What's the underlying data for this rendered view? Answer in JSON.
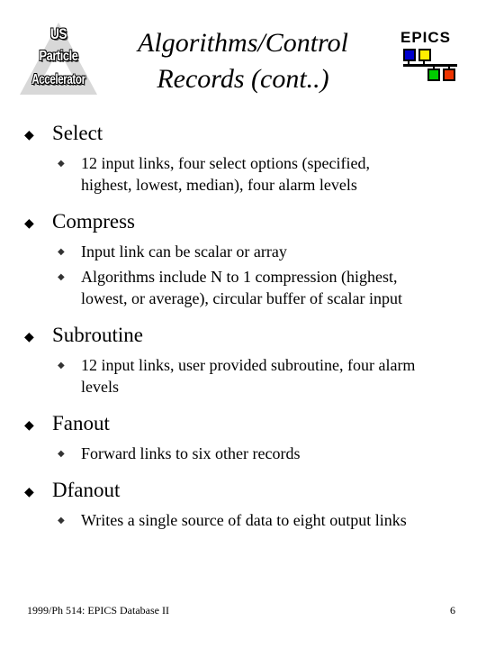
{
  "header": {
    "logo": {
      "line1": "US",
      "line2": "Particle",
      "line3": "Accelerator"
    },
    "title_line1": "Algorithms/Control",
    "title_line2": "Records (cont..)",
    "epics_label": "EPICS",
    "epics_colors": [
      "#0000cc",
      "#ffee00",
      "#00cc00",
      "#ee3300"
    ]
  },
  "bullets": [
    {
      "label": "Select",
      "subs": [
        [
          "12 input links, four select options (specified,",
          "highest, lowest, median), four alarm levels"
        ]
      ]
    },
    {
      "label": "Compress",
      "subs": [
        [
          "Input link can be scalar or array"
        ],
        [
          "Algorithms include N to 1 compression (highest,",
          "lowest, or average), circular buffer of scalar input"
        ]
      ]
    },
    {
      "label": "Subroutine",
      "subs": [
        [
          "12 input links, user provided subroutine, four alarm",
          "levels"
        ]
      ]
    },
    {
      "label": "Fanout",
      "subs": [
        [
          "Forward links to six other records"
        ]
      ]
    },
    {
      "label": "Dfanout",
      "subs": [
        [
          "Writes a single source of data to eight output links"
        ]
      ]
    }
  ],
  "footer": {
    "left": "1999/Ph 514: EPICS Database II",
    "page": "6"
  }
}
